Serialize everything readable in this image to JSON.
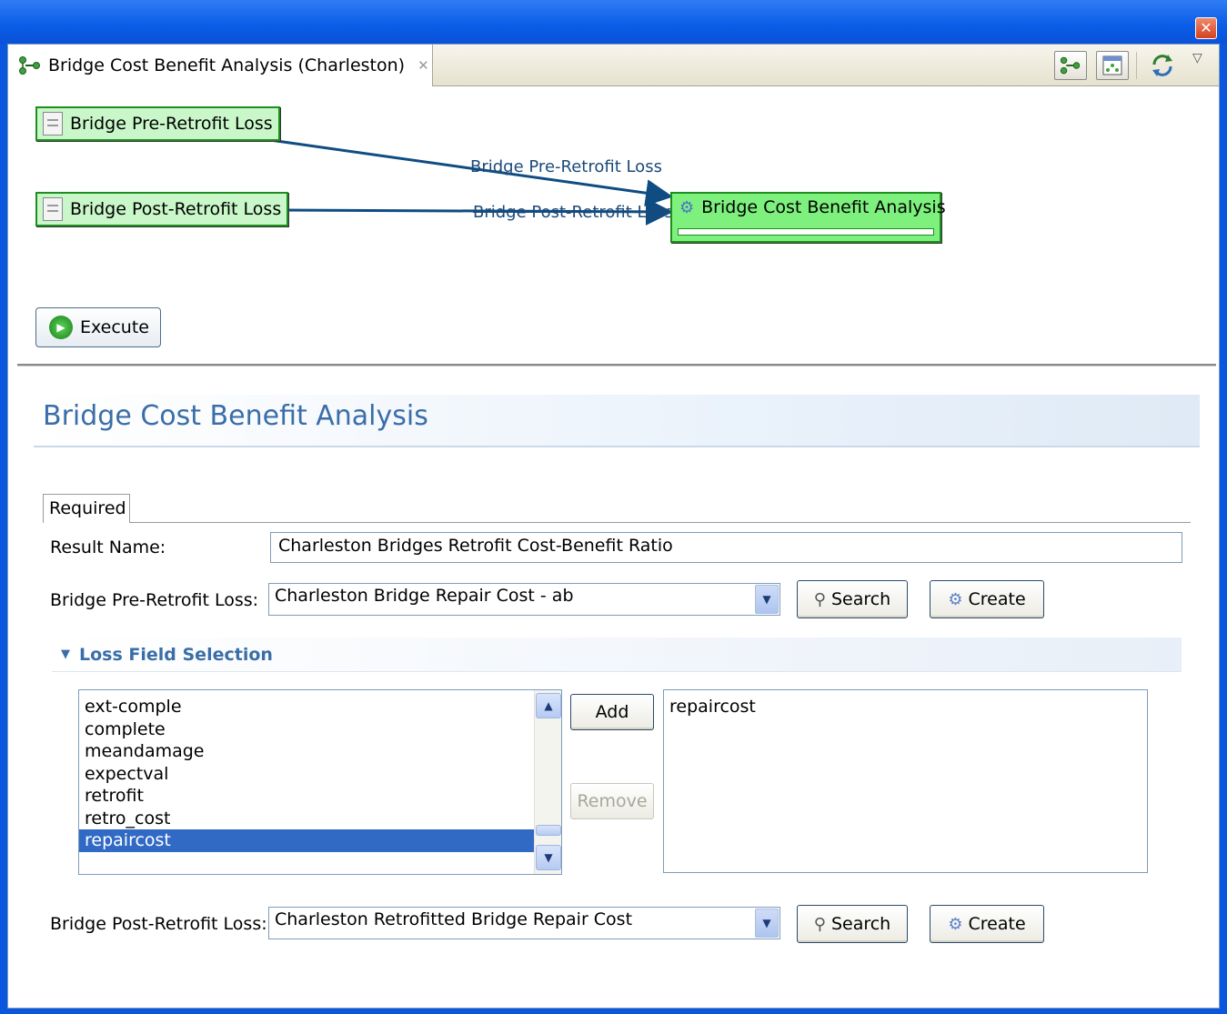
{
  "window": {
    "close_glyph": "✕"
  },
  "tab": {
    "title": "Bridge Cost Benefit Analysis (Charleston)",
    "close_glyph": "✕",
    "icon": "workflow-icon"
  },
  "toolbar": {
    "buttons": [
      {
        "name": "workflow-view-icon",
        "glyph": "⚭"
      },
      {
        "name": "layout-view-icon",
        "glyph": "⚃"
      },
      {
        "name": "refresh-icon",
        "glyph": "⟳"
      }
    ],
    "menu_glyph": "▽"
  },
  "workflow": {
    "nodes": [
      {
        "label": "Bridge Pre-Retrofit Loss"
      },
      {
        "label": "Bridge Post-Retrofit Loss"
      }
    ],
    "target": {
      "label": "Bridge Cost Benefit Analysis"
    },
    "edges": [
      {
        "label": "Bridge Pre-Retrofit Loss"
      },
      {
        "label": "Bridge Post-Retrofit Loss"
      }
    ],
    "edge_color": "#0f4c81",
    "execute_label": "Execute"
  },
  "form": {
    "title": "Bridge Cost Benefit Analysis",
    "tab_label": "Required",
    "result_name_label": "Result Name:",
    "result_name_value": "Charleston Bridges Retrofit Cost-Benefit Ratio",
    "pre_loss_label": "Bridge Pre-Retrofit Loss:",
    "pre_loss_value": "Charleston Bridge Repair Cost - ab",
    "post_loss_label": "Bridge Post-Retrofit Loss:",
    "post_loss_value": "Charleston Retrofitted Bridge Repair Cost",
    "search_label": "Search",
    "create_label": "Create",
    "section_title": "Loss Field Selection",
    "available_fields": [
      "ext-comple",
      "complete",
      "meandamage",
      "expectval",
      "retrofit",
      "retro_cost",
      "repaircost"
    ],
    "selected_available": "repaircost",
    "chosen_fields": [
      "repaircost"
    ],
    "add_label": "Add",
    "remove_label": "Remove"
  },
  "colors": {
    "node_fill": "#c9f7c9",
    "target_fill": "#7df07d",
    "title_blue": "#3a6ea8",
    "selection": "#316ac5"
  }
}
